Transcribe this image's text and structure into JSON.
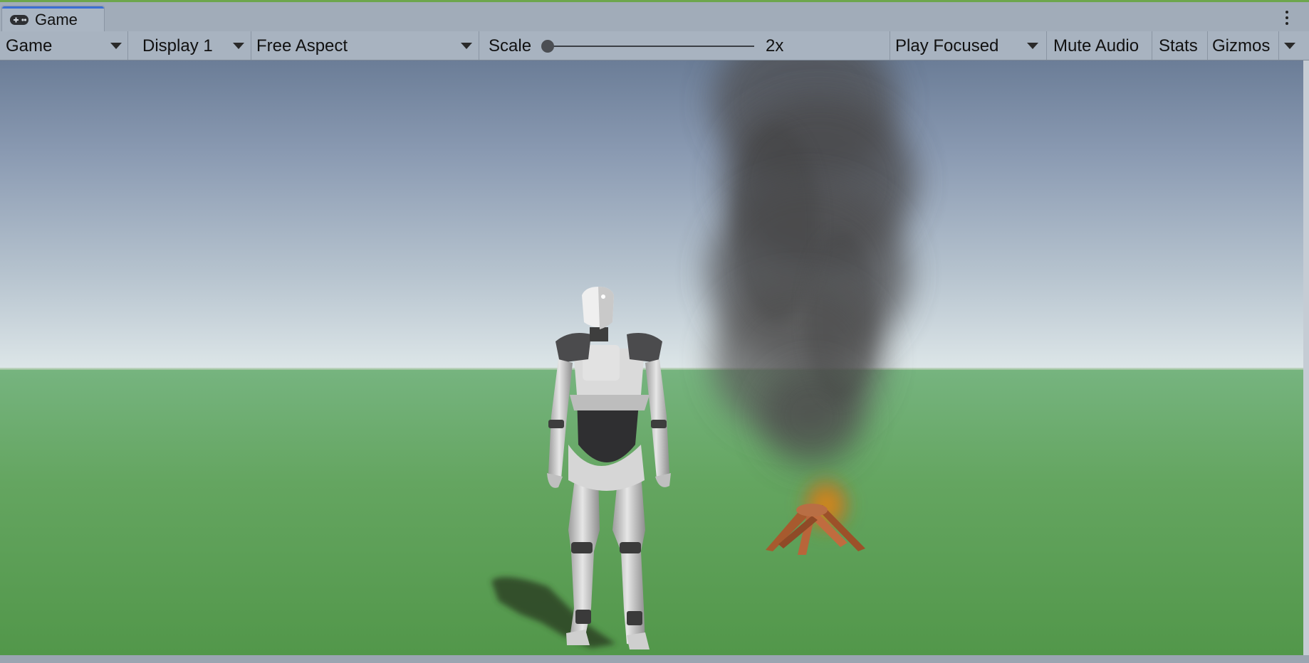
{
  "window": {
    "tab_title": "Game",
    "tab_icon": "gamepad-icon",
    "menu_icon": "kebab-menu-icon",
    "accent_color": "#3b6fd4",
    "top_line_color": "#6da64d"
  },
  "toolbar": {
    "view_select": "Game",
    "display_select": "Display 1",
    "aspect_select": "Free Aspect",
    "scale_label": "Scale",
    "scale_value": "2x",
    "scale_slider_fraction": 0.0,
    "play_mode_select": "Play Focused",
    "mute_audio_label": "Mute Audio",
    "stats_label": "Stats",
    "gizmos_label": "Gizmos"
  },
  "scene": {
    "sky_colors": [
      "#6b7d97",
      "#dde6e8"
    ],
    "ground_color": "#5fa35a",
    "character": "humanoid-robot",
    "campfire": "campfire-with-smoke"
  }
}
